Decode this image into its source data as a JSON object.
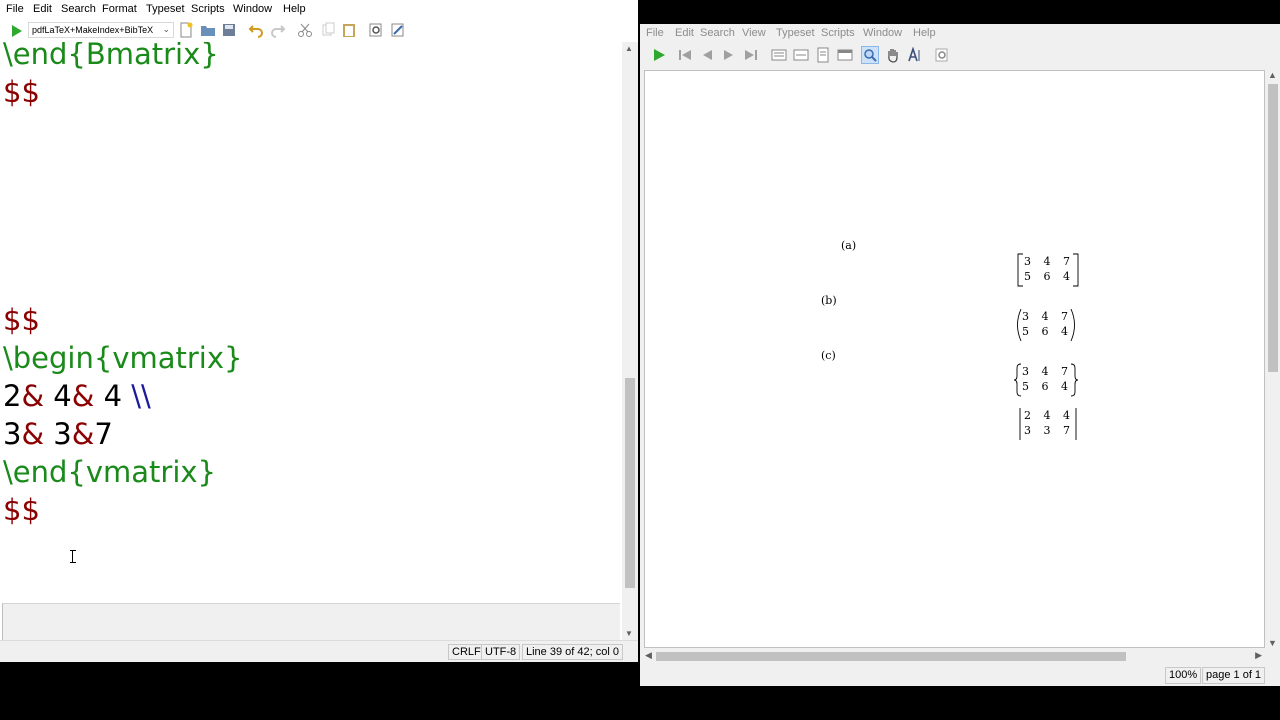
{
  "editor": {
    "menu": [
      "File",
      "Edit",
      "Search",
      "Format",
      "Typeset",
      "Scripts",
      "Window",
      "Help"
    ],
    "typeset_engine": "pdfLaTeX+MakeIndex+BibTeX",
    "code_lines": [
      {
        "parts": [
          {
            "t": "\\end{Bmatrix}",
            "c": "c-cmd"
          }
        ]
      },
      {
        "parts": [
          {
            "t": "$$",
            "c": "c-dollar"
          }
        ]
      },
      {
        "parts": [
          {
            "t": "",
            "c": "c-num"
          }
        ]
      },
      {
        "parts": [
          {
            "t": "",
            "c": "c-num"
          }
        ]
      },
      {
        "parts": [
          {
            "t": "",
            "c": "c-num"
          }
        ]
      },
      {
        "parts": [
          {
            "t": "",
            "c": "c-num"
          }
        ]
      },
      {
        "parts": [
          {
            "t": "",
            "c": "c-num"
          }
        ]
      },
      {
        "parts": [
          {
            "t": "$$",
            "c": "c-dollar"
          }
        ]
      },
      {
        "parts": [
          {
            "t": "\\begin{vmatrix}",
            "c": "c-cmd"
          }
        ]
      },
      {
        "parts": [
          {
            "t": "2",
            "c": "c-num"
          },
          {
            "t": "&",
            "c": "c-amp"
          },
          {
            "t": " 4",
            "c": "c-num"
          },
          {
            "t": "&",
            "c": "c-amp"
          },
          {
            "t": " 4 ",
            "c": "c-num"
          },
          {
            "t": "\\\\",
            "c": "c-nl"
          }
        ]
      },
      {
        "parts": [
          {
            "t": "3",
            "c": "c-num"
          },
          {
            "t": "&",
            "c": "c-amp"
          },
          {
            "t": " 3",
            "c": "c-num"
          },
          {
            "t": "&",
            "c": "c-amp"
          },
          {
            "t": "7",
            "c": "c-num"
          }
        ]
      },
      {
        "parts": [
          {
            "t": "\\end{vmatrix}",
            "c": "c-cmd"
          }
        ]
      },
      {
        "parts": [
          {
            "t": "$$",
            "c": "c-dollar"
          }
        ]
      }
    ],
    "status": {
      "line_ending": "CRLF",
      "encoding": "UTF-8",
      "position": "Line 39 of 42; col 0"
    }
  },
  "viewer": {
    "menu": [
      "File",
      "Edit",
      "Search",
      "View",
      "Typeset",
      "Scripts",
      "Window",
      "Help"
    ],
    "labels": [
      "(a)",
      "(b)",
      "(c)"
    ],
    "matrices": [
      {
        "type": "bracket",
        "rows": [
          [
            "3",
            "4",
            "7"
          ],
          [
            "5",
            "6",
            "4"
          ]
        ]
      },
      {
        "type": "paren",
        "rows": [
          [
            "3",
            "4",
            "7"
          ],
          [
            "5",
            "6",
            "4"
          ]
        ]
      },
      {
        "type": "brace",
        "rows": [
          [
            "3",
            "4",
            "7"
          ],
          [
            "5",
            "6",
            "4"
          ]
        ]
      },
      {
        "type": "vbar",
        "rows": [
          [
            "2",
            "4",
            "4"
          ],
          [
            "3",
            "3",
            "7"
          ]
        ]
      }
    ],
    "status": {
      "zoom": "100%",
      "page": "page 1 of 1"
    }
  }
}
